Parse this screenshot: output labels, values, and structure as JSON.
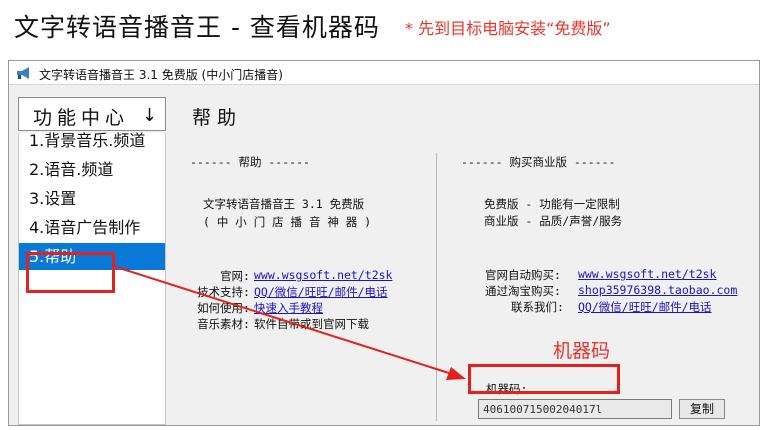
{
  "heading": {
    "title": "文字转语音播音王 - 查看机器码",
    "note": "* 先到目标电脑安装“免费版”"
  },
  "window": {
    "title": "文字转语音播音王 3.1 免费版  (中小门店播音)"
  },
  "menu": {
    "header": "功能中心",
    "items": [
      {
        "label": "1.背景音乐.频道"
      },
      {
        "label": "2.语音.频道"
      },
      {
        "label": "3.设置"
      },
      {
        "label": "4.语音广告制作"
      },
      {
        "label": "5.帮助"
      }
    ],
    "selected_index": 4
  },
  "help": {
    "title": "帮助",
    "left": {
      "section": "------ 帮助 ------",
      "app_name": "文字转语音播音王 3.1 免费版",
      "subtitle": "( 中 小 门 店 播 音 神 器 )",
      "website_label": "官网:",
      "website_link": "www.wsgsoft.net/t2sk",
      "support_label": "技术支持:",
      "support_link": "QQ/微信/旺旺/邮件/电话",
      "howto_label": "如何使用:",
      "howto_link": "快速入手教程",
      "material_label": "音乐素材:",
      "material_text": "软件自带或到官网下载"
    },
    "right": {
      "section": "------ 购买商业版 ------",
      "free_line": "免费版 - 功能有一定限制",
      "pro_line": "商业版 - 品质/声誉/服务",
      "buy_site_label": "官网自动购买:",
      "buy_site_link": "www.wsgsoft.net/t2sk",
      "taobao_label": "通过淘宝购买:",
      "taobao_link": "shop35976398.taobao.com",
      "contact_label": "联系我们:",
      "contact_link": "QQ/微信/旺旺/邮件/电话",
      "machine_code_label": "机器码:",
      "machine_code_value": "40610071500204017l",
      "copy_button": "复制"
    }
  },
  "annotation": {
    "label": "机器码",
    "color": "#e3211d"
  }
}
